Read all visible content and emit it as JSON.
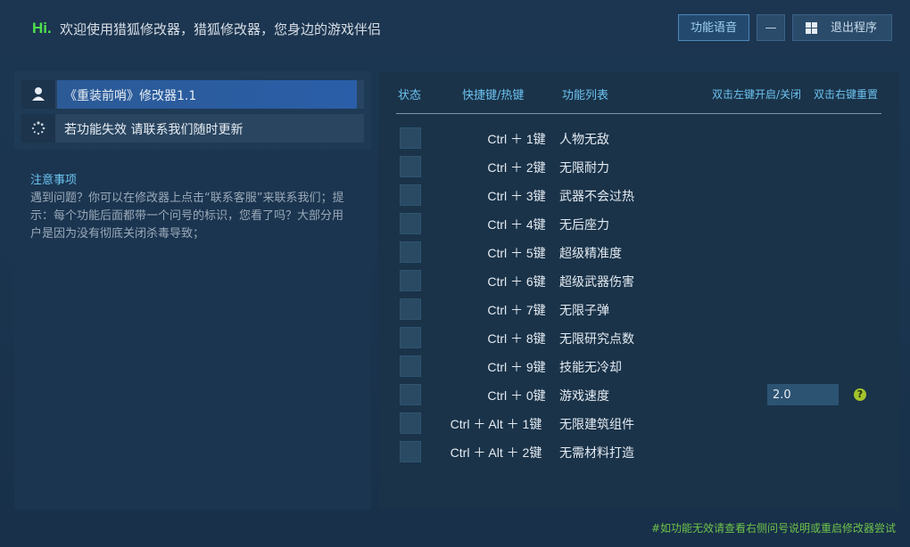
{
  "header": {
    "hi": "Hi.",
    "welcome": "欢迎使用猎狐修改器，猎狐修改器，您身边的游戏伴侣",
    "voice_button": "功能语音",
    "minimize_button": "—",
    "exit_button": "退出程序"
  },
  "sidebar": {
    "game_title": "《重装前哨》修改器1.1",
    "notice_text": "若功能失效  请联系我们随时更新"
  },
  "notes": {
    "title": "注意事项",
    "body": "遇到问题？你可以在修改器上点击“联系客服”来联系我们；提示：每个功能后面都带一个问号的标识，您看了吗？大部分用户是因为没有彻底关闭杀毒导致；"
  },
  "table": {
    "headers": {
      "status": "状态",
      "hotkey": "快捷键/热键",
      "functions": "功能列表",
      "left_click_hint": "双击左键开启/关闭",
      "right_click_hint": "双击右键重置"
    },
    "rows": [
      {
        "hotkey": "Ctrl ＋ 1键",
        "function": "人物无敌"
      },
      {
        "hotkey": "Ctrl ＋ 2键",
        "function": "无限耐力"
      },
      {
        "hotkey": "Ctrl ＋ 3键",
        "function": "武器不会过热"
      },
      {
        "hotkey": "Ctrl ＋ 4键",
        "function": "无后座力"
      },
      {
        "hotkey": "Ctrl ＋ 5键",
        "function": "超级精准度"
      },
      {
        "hotkey": "Ctrl ＋ 6键",
        "function": "超级武器伤害"
      },
      {
        "hotkey": "Ctrl ＋ 7键",
        "function": "无限子弹"
      },
      {
        "hotkey": "Ctrl ＋ 8键",
        "function": "无限研究点数"
      },
      {
        "hotkey": "Ctrl ＋ 9键",
        "function": "技能无冷却"
      },
      {
        "hotkey": "Ctrl ＋ 0键",
        "function": "游戏速度"
      },
      {
        "hotkey": "Ctrl ＋ Alt ＋ 1键",
        "function": "无限建筑组件"
      },
      {
        "hotkey": "Ctrl ＋ Alt ＋ 2键",
        "function": "无需材料打造"
      }
    ],
    "speed_value": "2.0",
    "help_glyph": "?"
  },
  "footer": {
    "hint": "#如功能无效请查看右侧问号说明或重启修改器尝试"
  },
  "colors": {
    "accent_blue": "#6dc2f0",
    "hi_green": "#4ee04e",
    "footer_green": "#6fc24a",
    "selected_row": "#2a5ea8",
    "help_badge": "#a4c22b"
  },
  "icons": {
    "user_icon": "user-icon",
    "loading_icon": "loading-spinner-icon",
    "windows_icon": "windows-icon",
    "help_icon": "question-mark-icon"
  }
}
